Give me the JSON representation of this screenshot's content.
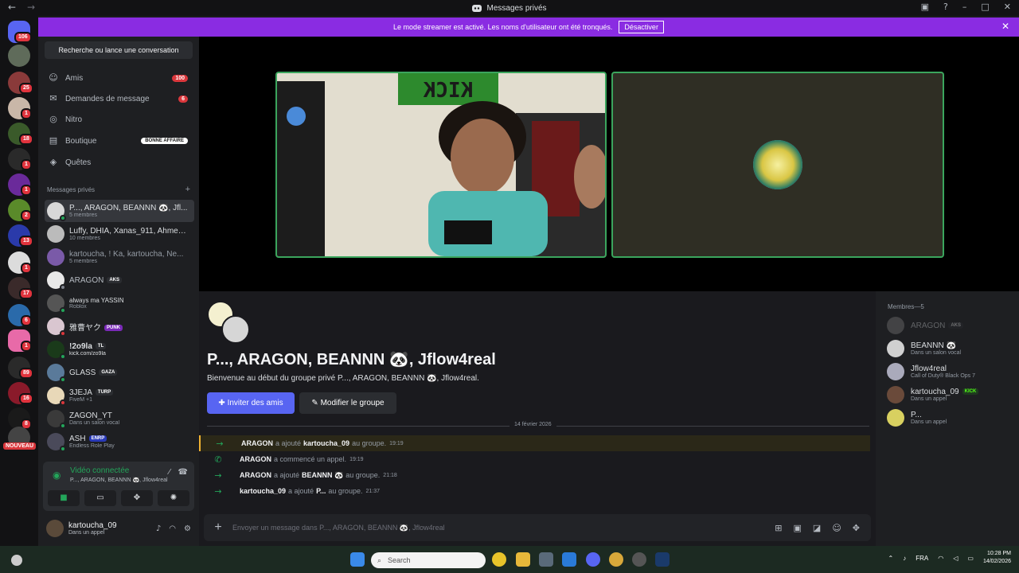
{
  "titlebar": {
    "title": "Messages privés",
    "back": "←",
    "forward": "→",
    "inbox_icon": "inbox-icon",
    "help_icon": "?",
    "minimize": "–",
    "maximize": "□",
    "close": "✕"
  },
  "banner": {
    "text": "Le mode streamer est activé. Les noms d'utilisateur ont été tronqués.",
    "button": "Désactiver",
    "close": "✕"
  },
  "guild_badges": {
    "g0": "106",
    "g2": "25",
    "g3": "1",
    "g4": "18",
    "g5": "1",
    "g6": "1",
    "g7": "2",
    "g8": "13",
    "g9": "1",
    "g10": "17",
    "g11": "6",
    "g12": "1",
    "g13": "89",
    "g14": "16",
    "g15": "8",
    "g16": "NOUVEAU"
  },
  "sidebar": {
    "search": "Recherche ou lance une conversation",
    "nav": [
      {
        "label": "Amis",
        "badge": "100",
        "icon": "friends-icon"
      },
      {
        "label": "Demandes de message",
        "badge": "6",
        "icon": "mail-icon"
      },
      {
        "label": "Nitro",
        "badge": "",
        "icon": "nitro-icon"
      },
      {
        "label": "Boutique",
        "badge": "BONNE AFFAIRE",
        "icon": "shop-icon"
      },
      {
        "label": "Quêtes",
        "badge": "",
        "icon": "quests-icon"
      }
    ],
    "dm_header": "Messages privés",
    "dm_add": "+",
    "dms": [
      {
        "name": "P..., ARAGON, BEANNN 🐼, Jfl...",
        "sub": "5 membres",
        "tag": ""
      },
      {
        "name": "Luffy, DHIA, Xanas_911, Ahmed...",
        "sub": "10 membres",
        "tag": ""
      },
      {
        "name": "kartoucha, ! Ka, kartoucha, Ne...",
        "sub": "5 membres",
        "tag": ""
      },
      {
        "name": "ARAGON",
        "sub": "",
        "tag": "AKS"
      },
      {
        "name": "always ma YASSIN",
        "sub": "Roblox",
        "tag": ""
      },
      {
        "name": "雅曹ヤク",
        "sub": "",
        "tag": "PUNK"
      },
      {
        "name": "!2o9la",
        "sub": "kick.com/zo9la",
        "tag": "TL"
      },
      {
        "name": "GLASS",
        "sub": "",
        "tag": "GAZA"
      },
      {
        "name": "3JEJA",
        "sub": "FiveM +1",
        "tag": "TURP"
      },
      {
        "name": "ZAGON_YT",
        "sub": "Dans un salon vocal",
        "tag": ""
      },
      {
        "name": "ASH",
        "sub": "Endless Role Play",
        "tag": "ENRP"
      }
    ],
    "voice": {
      "title": "Vidéo connectée",
      "channel": "P..., ARAGON, BEANNN 🐼, Jflow4real"
    },
    "user": {
      "name": "kartoucha_09",
      "status": "Dans un appel"
    }
  },
  "chat": {
    "title": "P..., ARAGON, BEANNN 🐼, Jflow4real",
    "welcome": "Bienvenue au début du groupe privé P..., ARAGON, BEANNN 🐼, Jflow4real.",
    "invite_btn": "Inviter des amis",
    "edit_btn": "Modifier le groupe",
    "date": "14 février 2026",
    "events": [
      {
        "actor": "ARAGON",
        "action": "a ajouté",
        "target": "kartoucha_09",
        "tail": "au groupe.",
        "time": "19:19",
        "icon": "→"
      },
      {
        "actor": "ARAGON",
        "action": "a commencé un appel.",
        "target": "",
        "tail": "",
        "time": "19:19",
        "icon": "✆"
      },
      {
        "actor": "ARAGON",
        "action": "a ajouté",
        "target": "BEANNN 🐼",
        "tail": "au groupe.",
        "time": "21:18",
        "icon": "→"
      },
      {
        "actor": "kartoucha_09",
        "action": "a ajouté",
        "target": "P...",
        "tail": "au groupe.",
        "time": "21:37",
        "icon": "→"
      }
    ],
    "composer_placeholder": "Envoyer un message dans P..., ARAGON, BEANNN 🐼, Jflow4real"
  },
  "members": {
    "header": "Membres—5",
    "list": [
      {
        "name": "ARAGON",
        "sub": "",
        "tag": "AKS"
      },
      {
        "name": "BEANNN 🐼",
        "sub": "Dans un salon vocal",
        "tag": ""
      },
      {
        "name": "Jflow4real",
        "sub": "Call of Duty® Black Ops 7",
        "tag": ""
      },
      {
        "name": "kartoucha_09",
        "sub": "Dans un appel",
        "tag": "KICK"
      },
      {
        "name": "P...",
        "sub": "Dans un appel",
        "tag": ""
      }
    ]
  },
  "stage": {
    "kick_sign": "KICK"
  },
  "taskbar": {
    "search": "Search",
    "lang": "FRA",
    "time": "10:28 PM",
    "date": "14/02/2026"
  },
  "colors": {
    "accent": "#5865f2",
    "banner": "#8a2ce2",
    "online": "#23a55a",
    "danger": "#da373c"
  }
}
